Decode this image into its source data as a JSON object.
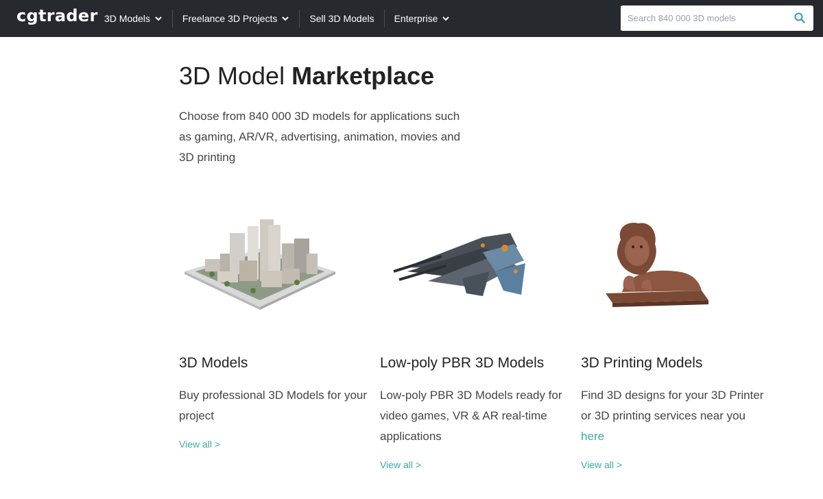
{
  "header": {
    "logo": "cgtrader",
    "nav": [
      {
        "label": "3D Models",
        "dropdown": true
      },
      {
        "label": "Freelance 3D Projects",
        "dropdown": true
      },
      {
        "label": "Sell 3D Models",
        "dropdown": false
      },
      {
        "label": "Enterprise",
        "dropdown": true
      }
    ],
    "search": {
      "placeholder": "Search 840 000 3D models",
      "icon": "search-icon"
    }
  },
  "hero": {
    "title_light": "3D Model",
    "title_bold": "Marketplace",
    "description": "Choose from 840 000 3D models for applications such as gaming, AR/VR, advertising, animation, movies and 3D printing"
  },
  "cards": [
    {
      "image": "city-model-illustration",
      "title": "3D Models",
      "description": "Buy professional 3D Models for your project",
      "link": "View all >"
    },
    {
      "image": "spaceship-model-illustration",
      "title": "Low-poly PBR 3D Models",
      "description": "Low-poly PBR 3D Models ready for video games, VR & AR real-time applications",
      "link": "View all >"
    },
    {
      "image": "lion-statue-illustration",
      "title": "3D Printing Models",
      "description": "Find 3D designs for your 3D Printer or 3D printing services near you",
      "description_link": "here",
      "link": "View all >"
    }
  ],
  "colors": {
    "header_bg": "#26292e",
    "accent": "#3ea7a7",
    "text": "#444444"
  }
}
